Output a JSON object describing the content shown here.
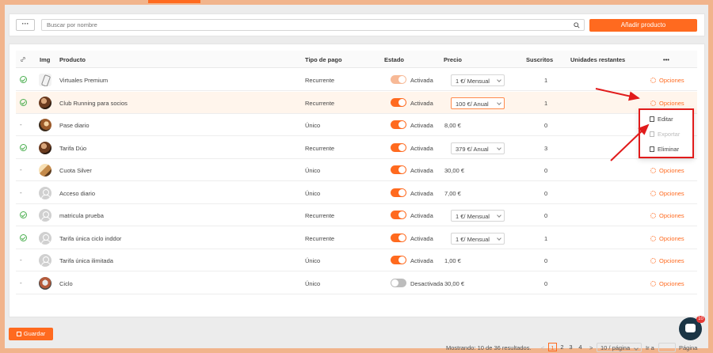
{
  "toolbar": {
    "more_label": "···",
    "search_placeholder": "Buscar por nombre",
    "add_label": "Añadir producto"
  },
  "table": {
    "headers": [
      "Img",
      "Producto",
      "Tipo de pago",
      "Estado",
      "Precio",
      "Suscritos",
      "Unidades restantes",
      "•••"
    ],
    "rows": [
      {
        "linked": true,
        "thumb": "phone",
        "name": "Virtuales Premium",
        "type": "Recurrente",
        "state_on": true,
        "state": "Activada",
        "price": "1 €/ Mensual",
        "price_select": true,
        "subs": "1",
        "options": "Opciones"
      },
      {
        "linked": true,
        "thumb": "photo",
        "name": "Club Running para socios",
        "type": "Recurrente",
        "state_on": true,
        "state": "Activada",
        "price": "100 €/ Anual",
        "price_select": true,
        "subs": "1",
        "options": "Opciones"
      },
      {
        "linked": false,
        "thumb": "photo2",
        "name": "Pase diario",
        "type": "Único",
        "state_on": true,
        "state": "Activada",
        "price": "8,00 €",
        "price_select": false,
        "subs": "0",
        "options": ""
      },
      {
        "linked": true,
        "thumb": "photo",
        "name": "Tarifa Dúo",
        "type": "Recurrente",
        "state_on": true,
        "state": "Activada",
        "price": "379 €/ Anual",
        "price_select": true,
        "subs": "3",
        "options": ""
      },
      {
        "linked": false,
        "thumb": "photo3",
        "name": "Cuota Silver",
        "type": "Único",
        "state_on": true,
        "state": "Activada",
        "price": "30,00 €",
        "price_select": false,
        "subs": "0",
        "options": "Opciones"
      },
      {
        "linked": false,
        "thumb": "user",
        "name": "Acceso diario",
        "type": "Único",
        "state_on": true,
        "state": "Activada",
        "price": "7,00 €",
        "price_select": false,
        "subs": "0",
        "options": "Opciones"
      },
      {
        "linked": true,
        "thumb": "user",
        "name": "matricula prueba",
        "type": "Recurrente",
        "state_on": true,
        "state": "Activada",
        "price": "1 €/ Mensual",
        "price_select": true,
        "subs": "0",
        "options": "Opciones"
      },
      {
        "linked": true,
        "thumb": "user",
        "name": "Tarifa única ciclo inddor",
        "type": "Recurrente",
        "state_on": true,
        "state": "Activada",
        "price": "1 €/ Mensual",
        "price_select": true,
        "subs": "1",
        "options": "Opciones"
      },
      {
        "linked": false,
        "thumb": "user",
        "name": "Tarifa única ilimitada",
        "type": "Único",
        "state_on": true,
        "state": "Activada",
        "price": "1,00 €",
        "price_select": false,
        "subs": "0",
        "options": "Opciones"
      },
      {
        "linked": false,
        "thumb": "photo4",
        "name": "Ciclo",
        "type": "Único",
        "state_on": false,
        "state": "Desactivada",
        "price": "30,00 €",
        "price_select": false,
        "subs": "0",
        "options": "Opciones"
      }
    ]
  },
  "dropdown": {
    "edit": "Editar",
    "export": "Exportar",
    "delete": "Eliminar"
  },
  "pagination": {
    "summary": "Mostrando: 10 de 36 resultados.",
    "pages": [
      "1",
      "2",
      "3",
      "4"
    ],
    "prev": "<",
    "next": ">",
    "per_page": "10 / página",
    "goto_label": "Ir a",
    "page_label": "Página"
  },
  "footer": {
    "save_label": "Guardar",
    "chat_badge": "10"
  },
  "colors": {
    "accent": "#ff6a1f",
    "success": "#4caf50",
    "annotation": "#e11b1b",
    "frame": "#f1b48c"
  }
}
